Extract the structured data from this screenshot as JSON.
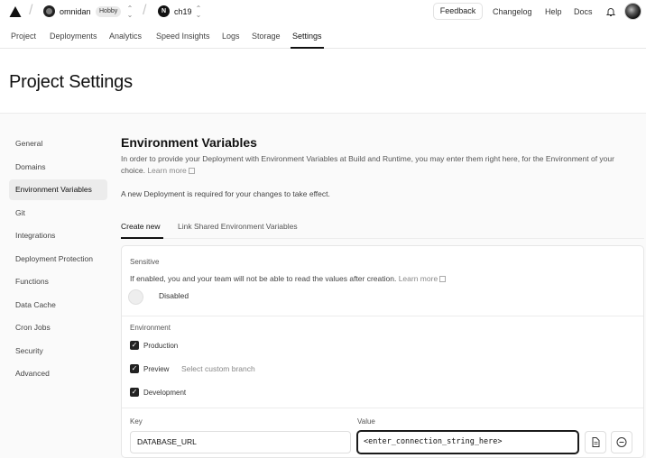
{
  "topbar": {
    "team_name": "omnidan",
    "plan_badge": "Hobby",
    "project_name": "ch19",
    "project_initial": "N",
    "feedback_label": "Feedback",
    "changelog_label": "Changelog",
    "help_label": "Help",
    "docs_label": "Docs"
  },
  "tabs": [
    "Project",
    "Deployments",
    "Analytics",
    "Speed Insights",
    "Logs",
    "Storage",
    "Settings"
  ],
  "active_tab": "Settings",
  "page_title": "Project Settings",
  "sidebar": {
    "items": [
      "General",
      "Domains",
      "Environment Variables",
      "Git",
      "Integrations",
      "Deployment Protection",
      "Functions",
      "Data Cache",
      "Cron Jobs",
      "Security",
      "Advanced"
    ],
    "active": "Environment Variables"
  },
  "env": {
    "title": "Environment Variables",
    "description": "In order to provide your Deployment with Environment Variables at Build and Runtime, you may enter them right here, for the Environment of your choice.",
    "learn_more": "Learn more",
    "notice": "A new Deployment is required for your changes to take effect.",
    "subtabs": [
      "Create new",
      "Link Shared Environment Variables"
    ],
    "sensitive_label": "Sensitive",
    "sensitive_desc": "If enabled, you and your team will not be able to read the values after creation.",
    "sensitive_learn_more": "Learn more",
    "sensitive_state": "Disabled",
    "environment_label": "Environment",
    "environments": [
      {
        "name": "Production",
        "checked": true
      },
      {
        "name": "Preview",
        "checked": true
      },
      {
        "name": "Development",
        "checked": true
      }
    ],
    "branch_placeholder": "Select custom branch",
    "key_label": "Key",
    "value_label": "Value",
    "key_value": "DATABASE_URL",
    "value_value": "<enter_connection_string_here>"
  },
  "colors": {
    "accent": "#111111",
    "muted_bg": "#fafafa",
    "active_item_bg": "#ececec"
  }
}
